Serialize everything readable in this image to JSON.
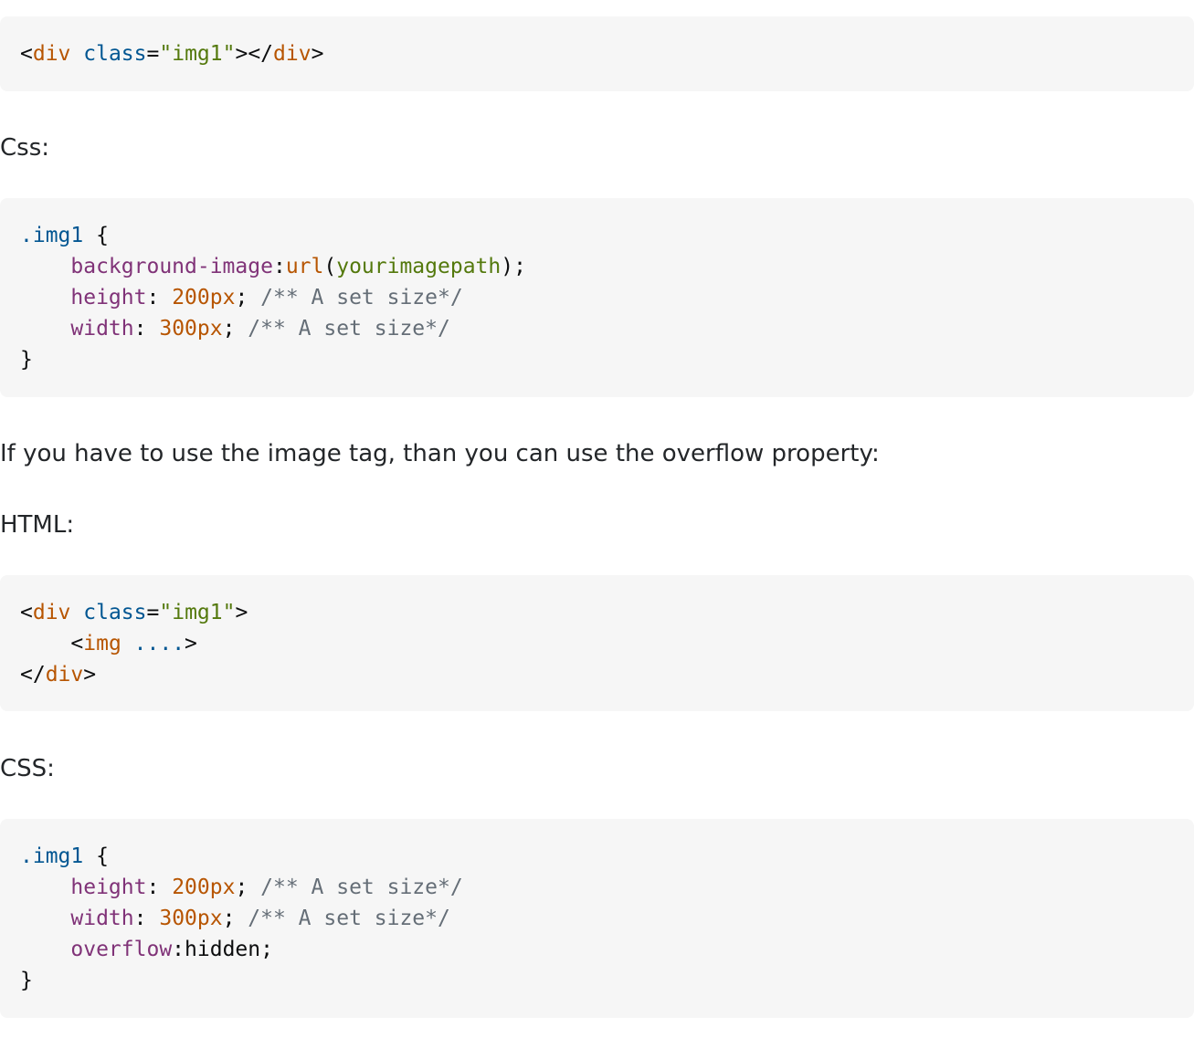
{
  "colors": {
    "page_background": "#ffffff",
    "code_background": "#f6f6f6",
    "text": "#232629",
    "syntax_tag": "#b75501",
    "syntax_attribute": "#015692",
    "syntax_string": "#54790d",
    "syntax_property": "#803378",
    "syntax_number": "#b75501",
    "syntax_comment": "#656e77"
  },
  "code1": {
    "line1": {
      "open": "<",
      "tag": "div",
      "sp": " ",
      "attr": "class",
      "eq": "=",
      "val": "\"img1\"",
      "close": "></",
      "tag2": "div",
      "end": ">"
    }
  },
  "label_css1": "Css:",
  "code2": {
    "line1": {
      "selector": ".img1",
      "brace": " {"
    },
    "line2": {
      "indent": "    ",
      "prop": "background-image",
      "colon": ":",
      "fn": "url",
      "paren_open": "(",
      "arg": "yourimagepath",
      "paren_close": ");"
    },
    "line3": {
      "indent": "    ",
      "prop": "height",
      "colon": ": ",
      "num": "200px",
      "semi": "; ",
      "comment": "/** A set size*/"
    },
    "line4": {
      "indent": "    ",
      "prop": "width",
      "colon": ": ",
      "num": "300px",
      "semi": "; ",
      "comment": "/** A set size*/"
    },
    "line5": {
      "brace": "}"
    }
  },
  "paragraph": "If you have to use the image tag, than you can use the overflow property:",
  "label_html": "HTML:",
  "code3": {
    "line1": {
      "open": "<",
      "tag": "div",
      "sp": " ",
      "attr": "class",
      "eq": "=",
      "val": "\"img1\"",
      "end": ">"
    },
    "line2": {
      "indent": "    ",
      "open": "<",
      "tag": "img",
      "sp": " ",
      "dots": "....",
      "end": ">"
    },
    "line3": {
      "open": "</",
      "tag": "div",
      "end": ">"
    }
  },
  "label_css2": "CSS:",
  "code4": {
    "line1": {
      "selector": ".img1",
      "brace": " {"
    },
    "line2": {
      "indent": "    ",
      "prop": "height",
      "colon": ": ",
      "num": "200px",
      "semi": "; ",
      "comment": "/** A set size*/"
    },
    "line3": {
      "indent": "    ",
      "prop": "width",
      "colon": ": ",
      "num": "300px",
      "semi": "; ",
      "comment": "/** A set size*/"
    },
    "line4": {
      "indent": "    ",
      "prop": "overflow",
      "colon": ":",
      "val": "hidden",
      "semi": ";"
    },
    "line5": {
      "brace": "}"
    }
  }
}
